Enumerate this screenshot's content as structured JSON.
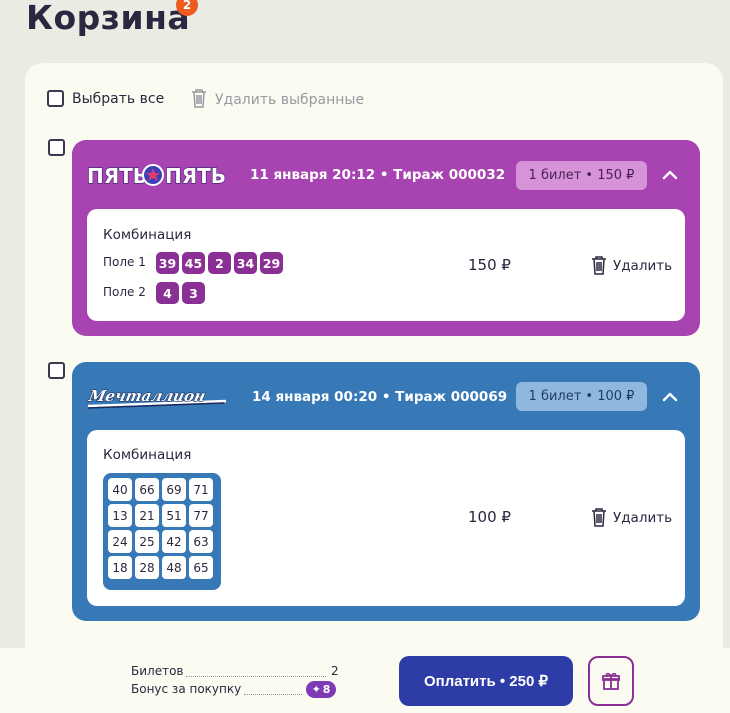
{
  "header": {
    "title": "Корзина",
    "badge_count": "2"
  },
  "toolbar": {
    "select_all_label": "Выбрать все",
    "delete_selected_label": "Удалить выбранные"
  },
  "tickets": [
    {
      "brand_logo_text": "ПЯТЬ ПЯТЬ",
      "draw_info": "11 января 20:12  •  Тираж 000032",
      "tickets_pill": "1 билет  •  150 ₽",
      "combination_label": "Комбинация",
      "field1_label": "Поле 1",
      "field1_numbers": [
        "39",
        "45",
        "2",
        "34",
        "29"
      ],
      "field2_label": "Поле 2",
      "field2_numbers": [
        "4",
        "3"
      ],
      "price": "150 ₽",
      "delete_label": "Удалить",
      "color": "#a744b1"
    },
    {
      "brand_logo_text": "Мечталлион",
      "draw_info": "14 января 00:20  •  Тираж 000069",
      "tickets_pill": "1 билет  •  100 ₽",
      "combination_label": "Комбинация",
      "grid_numbers": [
        "40",
        "66",
        "69",
        "71",
        "13",
        "21",
        "51",
        "77",
        "24",
        "25",
        "42",
        "63",
        "18",
        "28",
        "48",
        "65"
      ],
      "price": "100 ₽",
      "delete_label": "Удалить",
      "color": "#3779b7"
    }
  ],
  "footer": {
    "tickets_label": "Билетов",
    "tickets_count": "2",
    "bonus_label": "Бонус за покупку",
    "bonus_value": "8",
    "pay_button_label": "Оплатить • 250 ₽"
  }
}
